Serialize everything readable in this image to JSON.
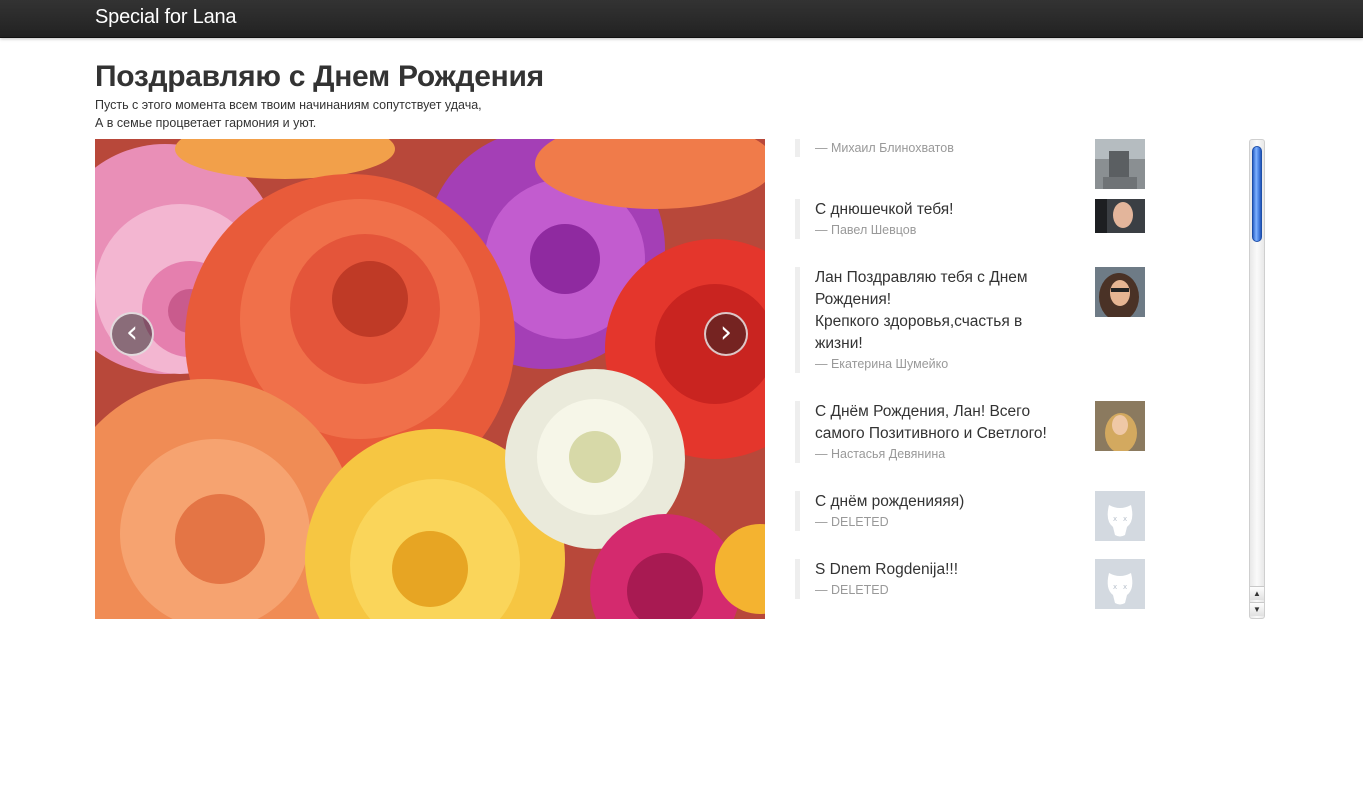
{
  "navbar": {
    "brand": "Special for Lana"
  },
  "hero": {
    "title": "Поздравляю с Днем Рождения",
    "line1": "Пусть с этого момента всем твоим начинаниям сопутствует удача,",
    "line2": "А в семье процветает гармония и уют."
  },
  "carousel": {
    "prev_label": "‹",
    "next_label": "›"
  },
  "wishes": [
    {
      "text": "",
      "author": "— Михаил Блинохватов",
      "avatar": "photo"
    },
    {
      "text": "С днюшечкой тебя!",
      "author": "— Павел Шевцов",
      "avatar": "photo"
    },
    {
      "text_lines": [
        "Лан Поздравляю тебя с Днем",
        "Рождения!",
        "Крепкого здоровья,счастья в",
        "жизни!"
      ],
      "author": "— Екатерина Шумейко",
      "avatar": "photo"
    },
    {
      "text_lines": [
        "С Днём Рождения, Лан! Всего",
        "самого Позитивного и Светлого!"
      ],
      "author": "— Настасья Девянина",
      "avatar": "photo"
    },
    {
      "text": "С днём рожденияяя)",
      "author": "— DELETED",
      "avatar": "deleted-dog-icon"
    },
    {
      "text": "S Dnem Rogdenija!!!",
      "author": "— DELETED",
      "avatar": "deleted-dog-icon"
    }
  ],
  "scrollbar": {
    "up_arrow": "▲",
    "down_arrow": "▼"
  }
}
